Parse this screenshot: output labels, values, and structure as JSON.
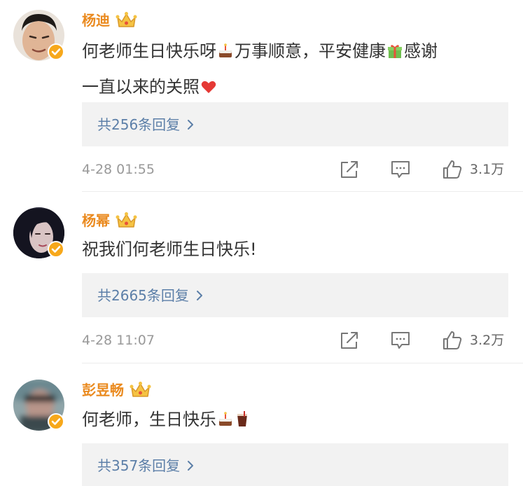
{
  "comments": [
    {
      "user": "杨迪",
      "text_line1": "何老师生日快乐呀",
      "text_line1b": "万事顺意，平安健康",
      "text_line1c": "感谢",
      "text_line2": "一直以来的关照",
      "replies": "共256条回复",
      "time": "4-28 01:55",
      "likes": "3.1万"
    },
    {
      "user": "杨幂",
      "text_line1": "祝我们何老师生日快乐!",
      "replies": "共2665条回复",
      "time": "4-28 11:07",
      "likes": "3.2万"
    },
    {
      "user": "彭昱畅",
      "text_line1": "何老师，生日快乐",
      "replies": "共357条回复"
    }
  ],
  "icons": {
    "crown": "crown-icon",
    "verified": "verified-icon",
    "share": "share-icon",
    "comment": "comment-icon",
    "like": "like-icon",
    "cake": "cake-emoji",
    "gift": "gift-emoji",
    "heart": "heart-emoji",
    "drink": "drink-emoji"
  },
  "colors": {
    "username": "#ea8a1f",
    "reply_link": "#5c7fa8",
    "reply_bg": "#f2f2f2",
    "verified": "#f7a81b"
  }
}
